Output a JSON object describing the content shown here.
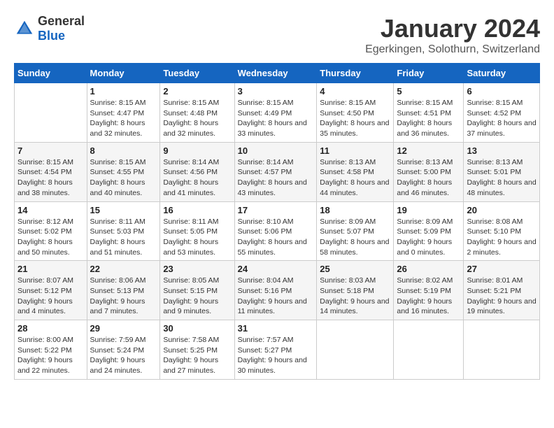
{
  "header": {
    "logo_general": "General",
    "logo_blue": "Blue",
    "month": "January 2024",
    "location": "Egerkingen, Solothurn, Switzerland"
  },
  "weekdays": [
    "Sunday",
    "Monday",
    "Tuesday",
    "Wednesday",
    "Thursday",
    "Friday",
    "Saturday"
  ],
  "weeks": [
    [
      {
        "day": "",
        "sunrise": "",
        "sunset": "",
        "daylight": ""
      },
      {
        "day": "1",
        "sunrise": "Sunrise: 8:15 AM",
        "sunset": "Sunset: 4:47 PM",
        "daylight": "Daylight: 8 hours and 32 minutes."
      },
      {
        "day": "2",
        "sunrise": "Sunrise: 8:15 AM",
        "sunset": "Sunset: 4:48 PM",
        "daylight": "Daylight: 8 hours and 32 minutes."
      },
      {
        "day": "3",
        "sunrise": "Sunrise: 8:15 AM",
        "sunset": "Sunset: 4:49 PM",
        "daylight": "Daylight: 8 hours and 33 minutes."
      },
      {
        "day": "4",
        "sunrise": "Sunrise: 8:15 AM",
        "sunset": "Sunset: 4:50 PM",
        "daylight": "Daylight: 8 hours and 35 minutes."
      },
      {
        "day": "5",
        "sunrise": "Sunrise: 8:15 AM",
        "sunset": "Sunset: 4:51 PM",
        "daylight": "Daylight: 8 hours and 36 minutes."
      },
      {
        "day": "6",
        "sunrise": "Sunrise: 8:15 AM",
        "sunset": "Sunset: 4:52 PM",
        "daylight": "Daylight: 8 hours and 37 minutes."
      }
    ],
    [
      {
        "day": "7",
        "sunrise": "Sunrise: 8:15 AM",
        "sunset": "Sunset: 4:54 PM",
        "daylight": "Daylight: 8 hours and 38 minutes."
      },
      {
        "day": "8",
        "sunrise": "Sunrise: 8:15 AM",
        "sunset": "Sunset: 4:55 PM",
        "daylight": "Daylight: 8 hours and 40 minutes."
      },
      {
        "day": "9",
        "sunrise": "Sunrise: 8:14 AM",
        "sunset": "Sunset: 4:56 PM",
        "daylight": "Daylight: 8 hours and 41 minutes."
      },
      {
        "day": "10",
        "sunrise": "Sunrise: 8:14 AM",
        "sunset": "Sunset: 4:57 PM",
        "daylight": "Daylight: 8 hours and 43 minutes."
      },
      {
        "day": "11",
        "sunrise": "Sunrise: 8:13 AM",
        "sunset": "Sunset: 4:58 PM",
        "daylight": "Daylight: 8 hours and 44 minutes."
      },
      {
        "day": "12",
        "sunrise": "Sunrise: 8:13 AM",
        "sunset": "Sunset: 5:00 PM",
        "daylight": "Daylight: 8 hours and 46 minutes."
      },
      {
        "day": "13",
        "sunrise": "Sunrise: 8:13 AM",
        "sunset": "Sunset: 5:01 PM",
        "daylight": "Daylight: 8 hours and 48 minutes."
      }
    ],
    [
      {
        "day": "14",
        "sunrise": "Sunrise: 8:12 AM",
        "sunset": "Sunset: 5:02 PM",
        "daylight": "Daylight: 8 hours and 50 minutes."
      },
      {
        "day": "15",
        "sunrise": "Sunrise: 8:11 AM",
        "sunset": "Sunset: 5:03 PM",
        "daylight": "Daylight: 8 hours and 51 minutes."
      },
      {
        "day": "16",
        "sunrise": "Sunrise: 8:11 AM",
        "sunset": "Sunset: 5:05 PM",
        "daylight": "Daylight: 8 hours and 53 minutes."
      },
      {
        "day": "17",
        "sunrise": "Sunrise: 8:10 AM",
        "sunset": "Sunset: 5:06 PM",
        "daylight": "Daylight: 8 hours and 55 minutes."
      },
      {
        "day": "18",
        "sunrise": "Sunrise: 8:09 AM",
        "sunset": "Sunset: 5:07 PM",
        "daylight": "Daylight: 8 hours and 58 minutes."
      },
      {
        "day": "19",
        "sunrise": "Sunrise: 8:09 AM",
        "sunset": "Sunset: 5:09 PM",
        "daylight": "Daylight: 9 hours and 0 minutes."
      },
      {
        "day": "20",
        "sunrise": "Sunrise: 8:08 AM",
        "sunset": "Sunset: 5:10 PM",
        "daylight": "Daylight: 9 hours and 2 minutes."
      }
    ],
    [
      {
        "day": "21",
        "sunrise": "Sunrise: 8:07 AM",
        "sunset": "Sunset: 5:12 PM",
        "daylight": "Daylight: 9 hours and 4 minutes."
      },
      {
        "day": "22",
        "sunrise": "Sunrise: 8:06 AM",
        "sunset": "Sunset: 5:13 PM",
        "daylight": "Daylight: 9 hours and 7 minutes."
      },
      {
        "day": "23",
        "sunrise": "Sunrise: 8:05 AM",
        "sunset": "Sunset: 5:15 PM",
        "daylight": "Daylight: 9 hours and 9 minutes."
      },
      {
        "day": "24",
        "sunrise": "Sunrise: 8:04 AM",
        "sunset": "Sunset: 5:16 PM",
        "daylight": "Daylight: 9 hours and 11 minutes."
      },
      {
        "day": "25",
        "sunrise": "Sunrise: 8:03 AM",
        "sunset": "Sunset: 5:18 PM",
        "daylight": "Daylight: 9 hours and 14 minutes."
      },
      {
        "day": "26",
        "sunrise": "Sunrise: 8:02 AM",
        "sunset": "Sunset: 5:19 PM",
        "daylight": "Daylight: 9 hours and 16 minutes."
      },
      {
        "day": "27",
        "sunrise": "Sunrise: 8:01 AM",
        "sunset": "Sunset: 5:21 PM",
        "daylight": "Daylight: 9 hours and 19 minutes."
      }
    ],
    [
      {
        "day": "28",
        "sunrise": "Sunrise: 8:00 AM",
        "sunset": "Sunset: 5:22 PM",
        "daylight": "Daylight: 9 hours and 22 minutes."
      },
      {
        "day": "29",
        "sunrise": "Sunrise: 7:59 AM",
        "sunset": "Sunset: 5:24 PM",
        "daylight": "Daylight: 9 hours and 24 minutes."
      },
      {
        "day": "30",
        "sunrise": "Sunrise: 7:58 AM",
        "sunset": "Sunset: 5:25 PM",
        "daylight": "Daylight: 9 hours and 27 minutes."
      },
      {
        "day": "31",
        "sunrise": "Sunrise: 7:57 AM",
        "sunset": "Sunset: 5:27 PM",
        "daylight": "Daylight: 9 hours and 30 minutes."
      },
      {
        "day": "",
        "sunrise": "",
        "sunset": "",
        "daylight": ""
      },
      {
        "day": "",
        "sunrise": "",
        "sunset": "",
        "daylight": ""
      },
      {
        "day": "",
        "sunrise": "",
        "sunset": "",
        "daylight": ""
      }
    ]
  ]
}
